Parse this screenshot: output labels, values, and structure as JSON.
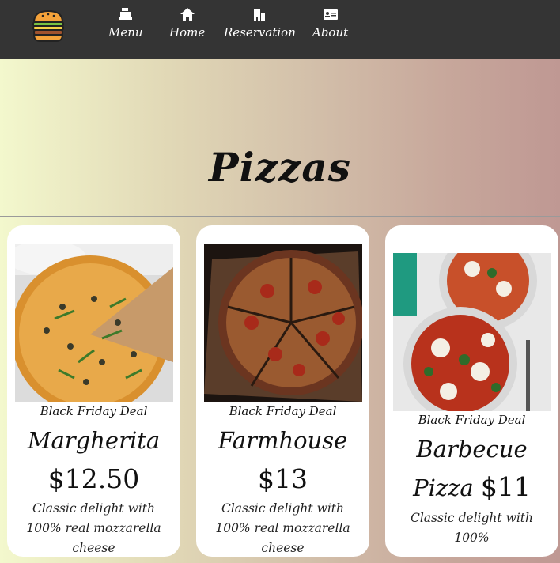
{
  "nav": {
    "items": [
      {
        "label": "Menu",
        "icon": "cash-register-icon"
      },
      {
        "label": "Home",
        "icon": "home-icon"
      },
      {
        "label": "Reservation",
        "icon": "building-icon"
      },
      {
        "label": "About",
        "icon": "id-card-icon"
      }
    ]
  },
  "logo": {
    "icon": "burger-icon"
  },
  "hero": {
    "title": "Pizzas"
  },
  "cards": [
    {
      "deal": "Black Friday Deal",
      "name": "Margherita",
      "price": "$12.50",
      "desc": "Classic delight with 100% real mozzarella cheese",
      "image": "margherita-pizza-photo"
    },
    {
      "deal": "Black Friday Deal",
      "name": "Farmhouse",
      "price": "$13",
      "desc": "Classic delight with 100% real mozzarella cheese",
      "image": "farmhouse-pizza-photo"
    },
    {
      "deal": "Black Friday Deal",
      "name": "Barbecue Pizza",
      "price": "$11",
      "desc": "Classic delight with 100%",
      "image": "barbecue-pizza-photo"
    }
  ],
  "colors": {
    "navbar": "#343434",
    "card": "#ffffff",
    "text": "#111111"
  }
}
